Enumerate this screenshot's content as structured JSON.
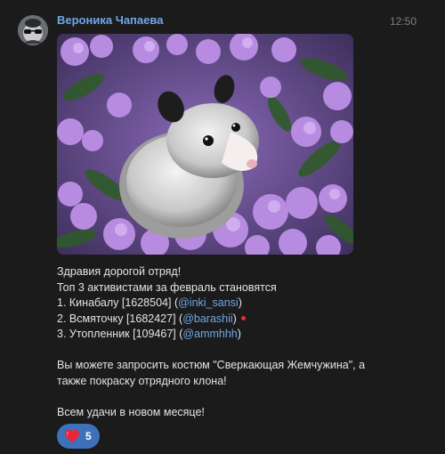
{
  "message": {
    "author": "Вероника Чапаева",
    "time": "12:50",
    "image": {
      "subject": "opossum-in-purple-flowers"
    },
    "text": {
      "line1": "Здравия дорогой отряд!",
      "line2": "Топ 3 активистами за февраль становятся",
      "list": [
        {
          "prefix": "1. Кинабалу [1628504] (",
          "mention": "@inki_sansi",
          "suffix": ")"
        },
        {
          "prefix": "2. Всмяточку [1682427] (",
          "mention": "@barashii",
          "suffix": ")"
        },
        {
          "prefix": "3. Утопленник [109467] (",
          "mention": "@ammhhh",
          "suffix": ")"
        }
      ],
      "para2_line1": "Вы можете запросить костюм \"Сверкающая Жемчужина\", а",
      "para2_line2": "также покраску отрядного клона!",
      "para3": "Всем удачи в новом месяце!"
    },
    "reaction": {
      "icon": "heart-icon",
      "count": "5",
      "color": "#3d72b8"
    }
  },
  "colors": {
    "background": "#1b1b1b",
    "author": "#6fa8e8",
    "mention": "#6fa8e8",
    "text": "#e3e3e3",
    "time": "#7e7e7e",
    "status_dot": "#e0303a"
  }
}
